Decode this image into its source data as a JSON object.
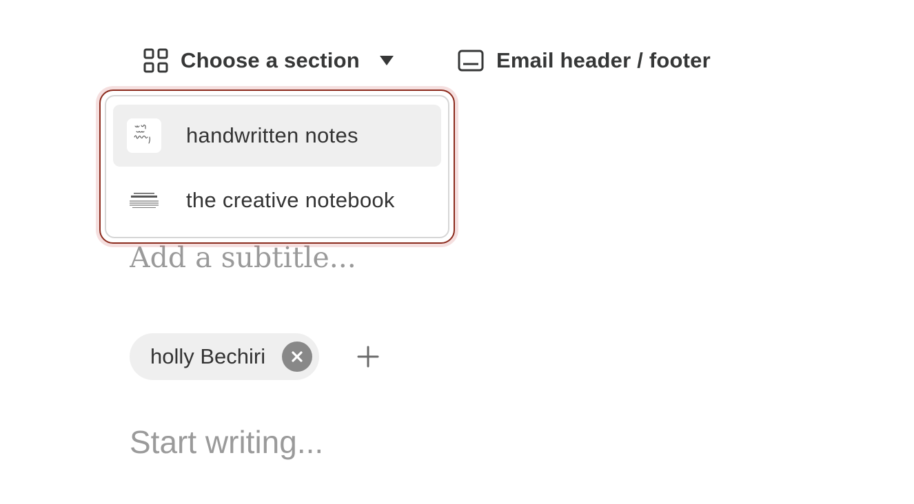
{
  "toolbar": {
    "section_picker": {
      "label": "Choose a section",
      "icon": "grid-icon",
      "caret_icon": "caret-down-icon"
    },
    "email_header_footer": {
      "label": "Email header / footer",
      "icon": "card-icon"
    }
  },
  "dropdown": {
    "items": [
      {
        "label": "handwritten notes",
        "thumbnail": "handwritten-notes-thumbnail",
        "active": true
      },
      {
        "label": "the creative notebook",
        "thumbnail": "creative-notebook-thumbnail",
        "active": false
      }
    ]
  },
  "editor": {
    "subtitle_placeholder": "Add a subtitle...",
    "author": {
      "name": "holly Bechiri"
    },
    "body_placeholder": "Start writing..."
  },
  "colors": {
    "dropdown_border": "#8b2a1c",
    "active_item_bg": "#efefef",
    "chip_bg": "#efefef",
    "placeholder": "#999999"
  }
}
